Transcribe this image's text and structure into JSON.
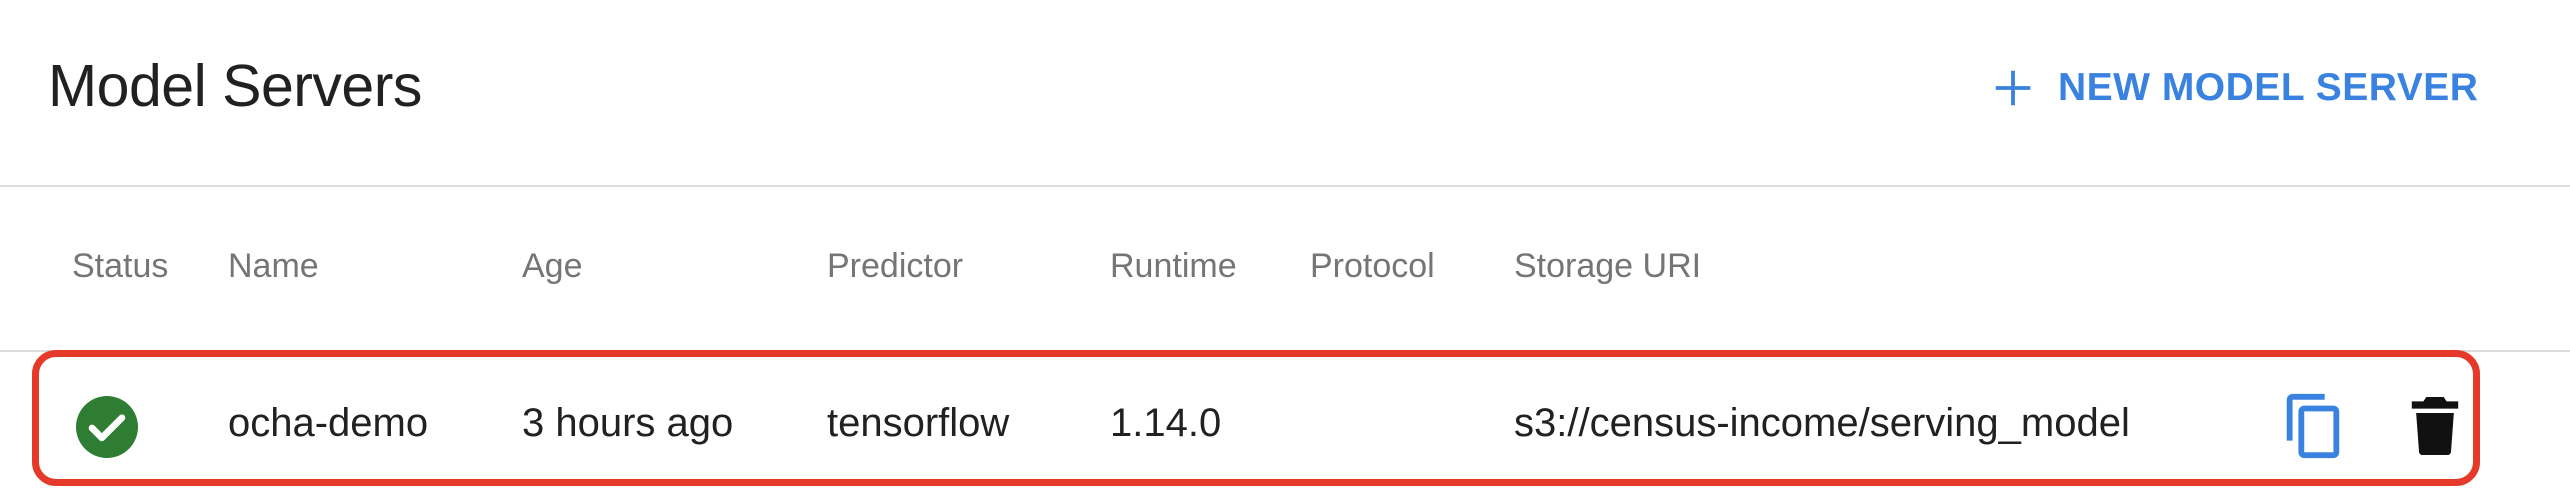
{
  "header": {
    "title": "Model Servers",
    "new_button_label": "NEW MODEL SERVER"
  },
  "table": {
    "columns": {
      "status": "Status",
      "name": "Name",
      "age": "Age",
      "predictor": "Predictor",
      "runtime": "Runtime",
      "protocol": "Protocol",
      "storage_uri": "Storage URI"
    },
    "rows": [
      {
        "status": "ready",
        "name": "ocha-demo",
        "age": "3 hours ago",
        "predictor": "tensorflow",
        "runtime": "1.14.0",
        "protocol": "",
        "storage_uri": "s3://census-income/serving_model"
      }
    ]
  },
  "icons": {
    "add": "plus-icon",
    "status_ready": "check-circle-icon",
    "copy": "copy-icon",
    "delete": "trash-icon"
  },
  "colors": {
    "accent": "#3a82e0",
    "status_ok": "#2e7d32",
    "highlight": "#e53a2a",
    "header_text": "#757575"
  }
}
